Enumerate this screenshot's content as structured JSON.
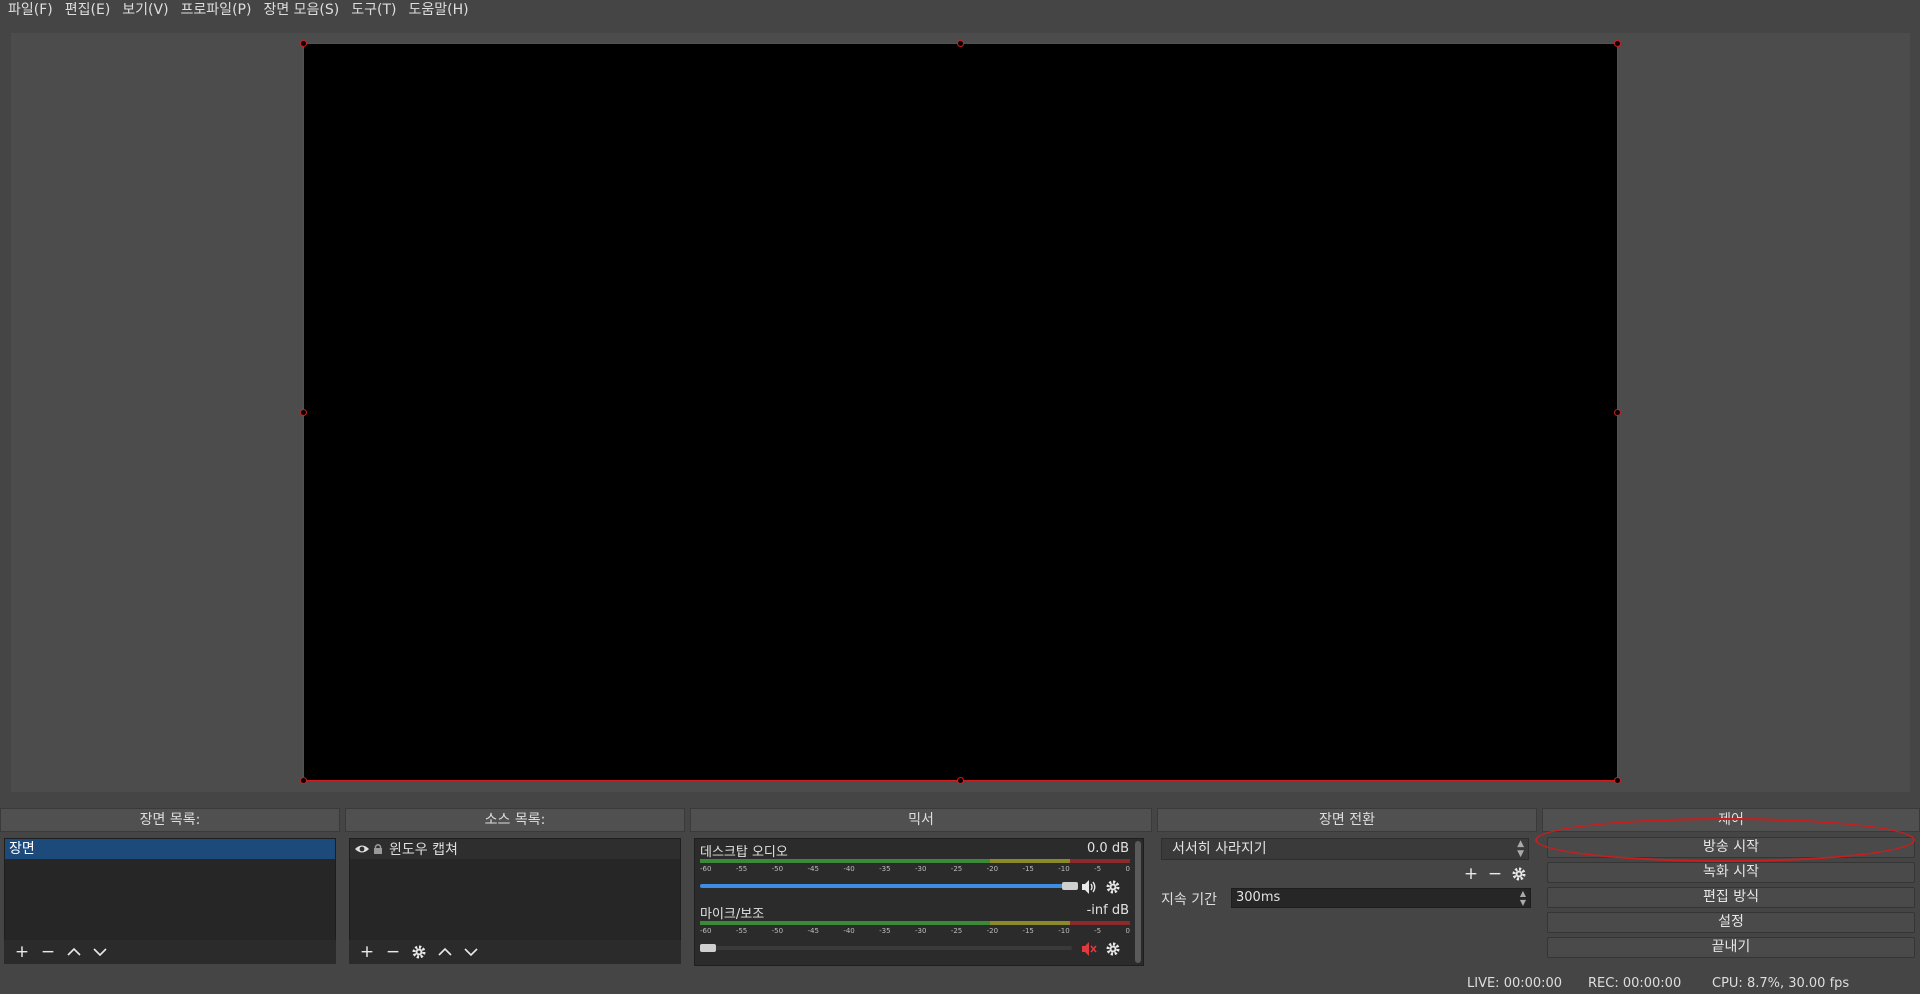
{
  "menu": [
    "파일(F)",
    "편집(E)",
    "보기(V)",
    "프로파일(P)",
    "장면 모음(S)",
    "도구(T)",
    "도움말(H)"
  ],
  "docks": {
    "scenes": {
      "title": "장면 목록:",
      "items": [
        "장면"
      ]
    },
    "sources": {
      "title": "소스 목록:",
      "items": [
        "윈도우 캡쳐"
      ]
    },
    "mixer": {
      "title": "믹서",
      "tracks": [
        {
          "name": "데스크탑 오디오",
          "db": "0.0 dB",
          "volume": 1.0,
          "muted": false
        },
        {
          "name": "마이크/보조",
          "db": "-inf dB",
          "volume": 0.0,
          "muted": true
        }
      ],
      "ticks": [
        "-60",
        "-55",
        "-50",
        "-45",
        "-40",
        "-35",
        "-30",
        "-25",
        "-20",
        "-15",
        "-10",
        "-5",
        "0"
      ]
    },
    "transitions": {
      "title": "장면 전환",
      "selected": "서서히 사라지기",
      "duration_label": "지속 기간",
      "duration_value": "300ms"
    },
    "controls": {
      "title": "제어",
      "buttons": [
        "방송 시작",
        "녹화 시작",
        "편집 방식",
        "설정",
        "끝내기"
      ]
    }
  },
  "status": {
    "live": "LIVE: 00:00:00",
    "rec": "REC: 00:00:00",
    "cpu": "CPU: 8.7%, 30.00 fps"
  },
  "colors": {
    "accent_selection": "#1c4a7a",
    "preview_border": "#d41b1b",
    "annotation": "#c81e1e",
    "slider_blue": "#3d8ee0"
  },
  "icons": {
    "add": "plus-icon",
    "remove": "minus-icon",
    "up": "chevron-up-icon",
    "down": "chevron-down-icon",
    "settings": "gear-icon",
    "visible": "eye-icon",
    "lock": "lock-icon",
    "speaker": "speaker-icon",
    "muted": "speaker-muted-icon"
  }
}
